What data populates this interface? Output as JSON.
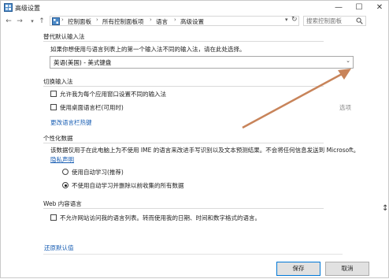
{
  "window": {
    "title": "高级设置",
    "minimize_glyph": "—",
    "maximize_glyph": "☐",
    "close_glyph": "✕"
  },
  "address_bar": {
    "back_glyph": "←",
    "forward_glyph": "→",
    "up_glyph": "↑",
    "crumbs": [
      "控制面板",
      "所有控制面板项",
      "语言",
      "高级设置"
    ],
    "separator": "›",
    "search_placeholder": "搜索控制面板"
  },
  "sections": {
    "override_input": {
      "heading": "替代默认输入法",
      "description": "如果你想使用与语言列表上的第一个输入法不同的输入法，请在此处选择。",
      "selected_value": "英语(美国) - 美式键盘"
    },
    "switch_input": {
      "heading": "切换输入法",
      "checkbox1_label": "允许我为每个应用窗口设置不同的输入法",
      "checkbox2_label": "使用桌面语言栏(可用时)",
      "options_link": "选项",
      "hotkeys_link": "更改语言栏热键"
    },
    "personalization": {
      "heading": "个性化数据",
      "description": "该数据仅用于在此电脑上为不使用 IME 的语言来改进手写识别以及文本预测结果。不会将任何信息发送到 Microsoft。",
      "privacy_link": "隐私声明",
      "radio1_label": "使用自动学习(推荐)",
      "radio2_label": "不使用自动学习并删除以前收集的所有数据"
    },
    "web_language": {
      "heading": "Web 内容语言",
      "checkbox_label": "不允许网站访问我的语言列表。转而使用我的日期、时间和数字格式的语言。"
    }
  },
  "restore_link": "还原默认值",
  "buttons": {
    "save": "保存",
    "cancel": "取消"
  },
  "colors": {
    "accent": "#0078d7",
    "link": "#1a5fb4",
    "annotation_arrow": "#c8845a"
  }
}
